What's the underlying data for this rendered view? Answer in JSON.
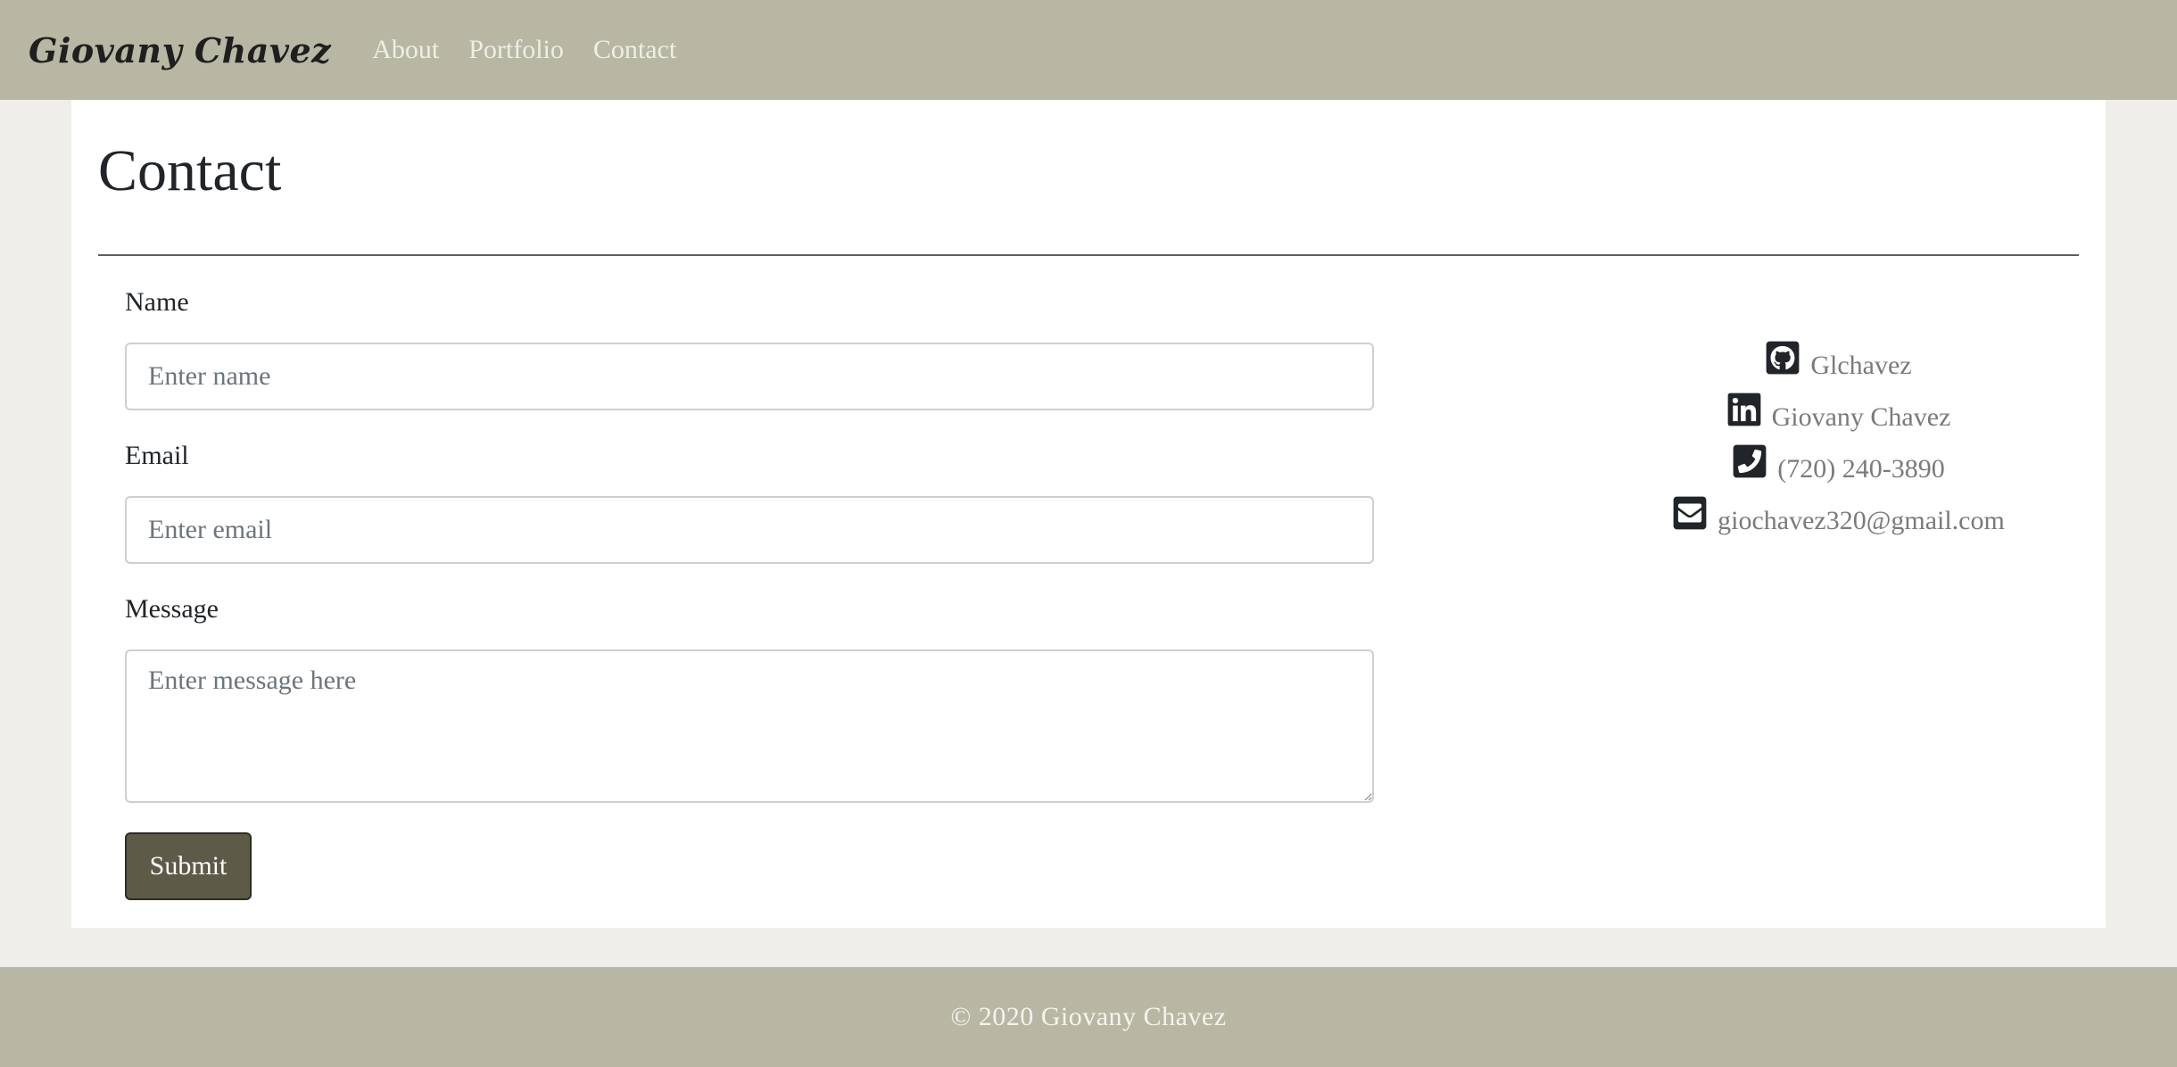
{
  "nav": {
    "brand": "Giovany Chavez",
    "links": [
      {
        "label": "About"
      },
      {
        "label": "Portfolio"
      },
      {
        "label": "Contact"
      }
    ]
  },
  "page": {
    "title": "Contact"
  },
  "form": {
    "name_label": "Name",
    "name_placeholder": "Enter name",
    "name_value": "",
    "email_label": "Email",
    "email_placeholder": "Enter email",
    "email_value": "",
    "message_label": "Message",
    "message_placeholder": "Enter message here",
    "message_value": "",
    "submit_label": "Submit"
  },
  "contact": {
    "items": [
      {
        "icon": "github-icon",
        "text": "Glchavez"
      },
      {
        "icon": "linkedin-icon",
        "text": "Giovany Chavez"
      },
      {
        "icon": "phone-icon",
        "text": "(720) 240-3890"
      },
      {
        "icon": "envelope-icon",
        "text": "giochavez320@gmail.com"
      }
    ]
  },
  "footer": {
    "text": "© 2020 Giovany Chavez"
  },
  "colors": {
    "nav_bg": "#b7b7a4",
    "page_bg": "#efeeea",
    "button_bg": "#5d5a48",
    "icon_color": "#212529",
    "contact_text": "#7a7a7a"
  }
}
